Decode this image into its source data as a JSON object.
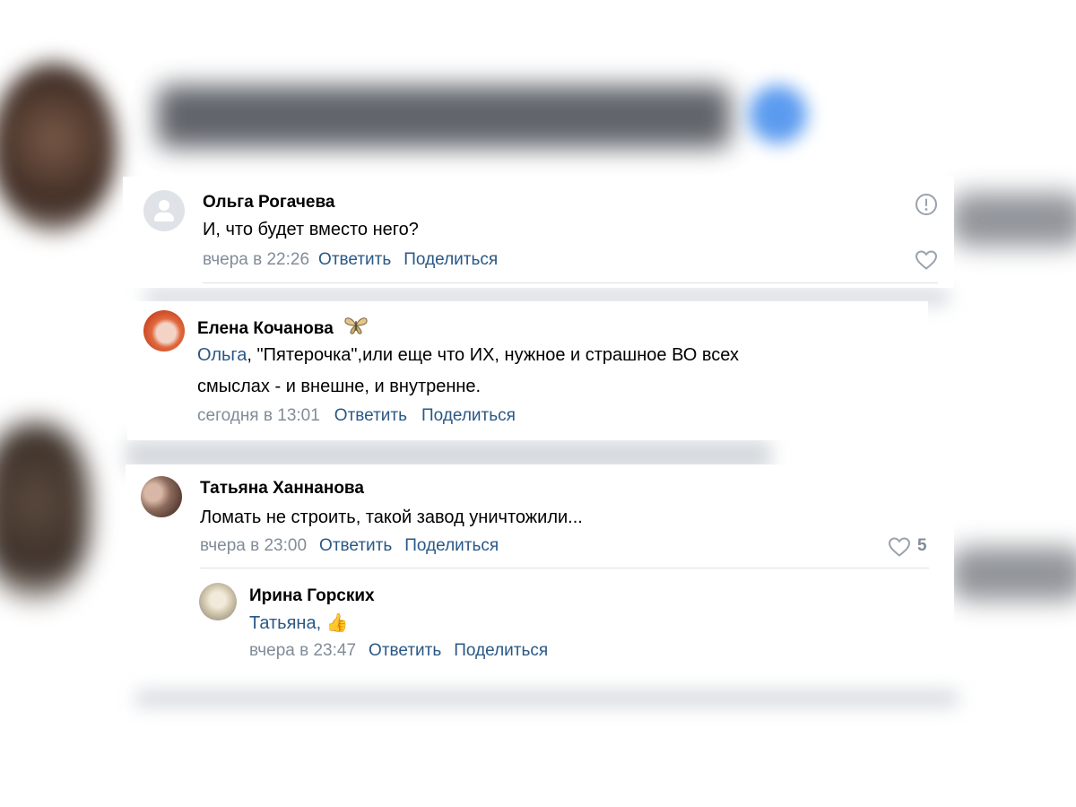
{
  "comments": [
    {
      "author": "Ольга Рогачева",
      "text": "И, что будет вместо него?",
      "time": "вчера в 22:26",
      "reply_label": "Ответить",
      "share_label": "Поделиться"
    },
    {
      "author": "Елена Кочанова",
      "mention": "Ольга",
      "text_line1": ", \"Пятерочка\",или еще что ИХ, нужное и страшное ВО всех",
      "text_line2": "смыслах - и внешне, и внутренне.",
      "time": "сегодня в 13:01",
      "reply_label": "Ответить",
      "share_label": "Поделиться"
    },
    {
      "author": "Татьяна Ханнанова",
      "text": "Ломать не строить, такой завод уничтожили...",
      "time": "вчера в 23:00",
      "reply_label": "Ответить",
      "share_label": "Поделиться",
      "likes": "5"
    },
    {
      "author": "Ирина Горских",
      "mention": "Татьяна,",
      "emoji": "👍",
      "time": "вчера в 23:47",
      "reply_label": "Ответить",
      "share_label": "Поделиться"
    }
  ],
  "colors": {
    "link": "#2a5885",
    "meta": "#818c99",
    "divider": "#dce1e6"
  },
  "icons": [
    "user-avatar-placeholder-icon",
    "report-icon",
    "heart-icon",
    "butterfly-emoji-icon"
  ]
}
